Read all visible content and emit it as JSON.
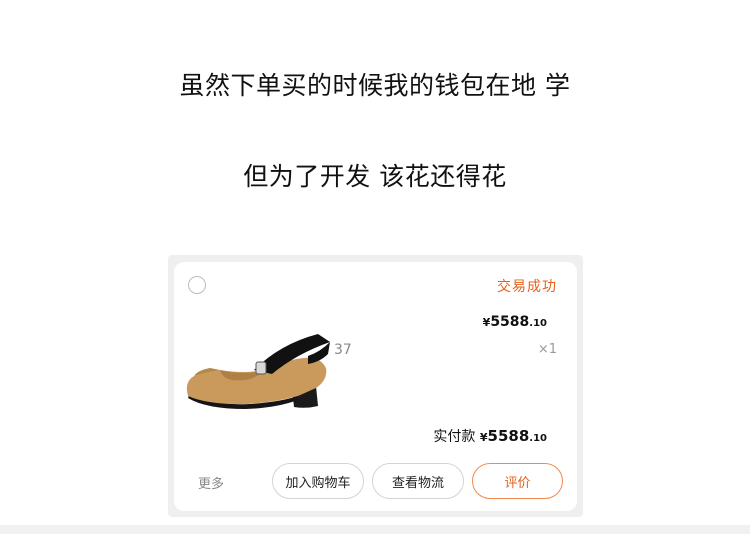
{
  "captions": {
    "line1": "虽然下单买的时候我的钱包在地 学",
    "line2": "但为了开发 该花还得花"
  },
  "order": {
    "status": "交易成功",
    "currency": "¥",
    "price_int": "5588",
    "price_dec": ".10",
    "size": "37",
    "quantity": "×1",
    "paid_label": "实付款",
    "paid_int": "5588",
    "paid_dec": ".10"
  },
  "actions": {
    "more": "更多",
    "add_to_cart": "加入购物车",
    "view_logistics": "查看物流",
    "review": "评价"
  },
  "colors": {
    "accent": "#e8601c"
  },
  "icons": {
    "select": "radio-unchecked-icon",
    "product": "shoe-image"
  }
}
